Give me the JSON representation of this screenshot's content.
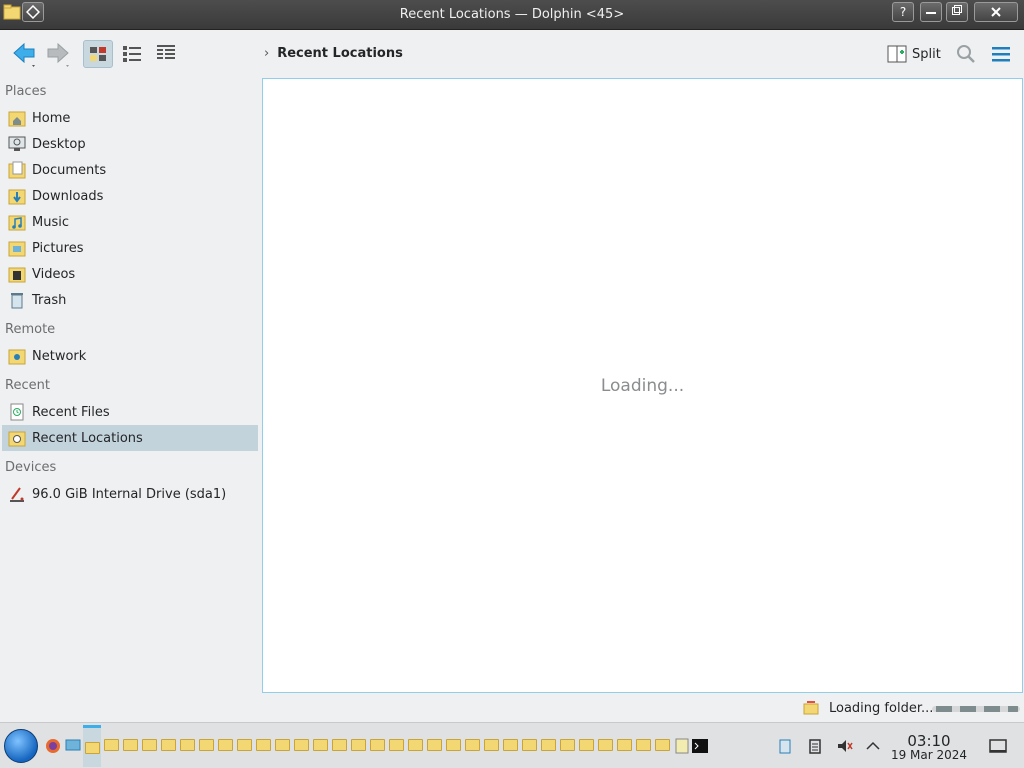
{
  "window": {
    "title": "Recent Locations — Dolphin <45>",
    "help_label": "?"
  },
  "toolbar": {
    "breadcrumb": "Recent Locations",
    "split_label": "Split"
  },
  "sidebar": {
    "sections": [
      {
        "title": "Places",
        "items": [
          {
            "label": "Home",
            "icon": "home-folder-icon"
          },
          {
            "label": "Desktop",
            "icon": "desktop-icon"
          },
          {
            "label": "Documents",
            "icon": "documents-folder-icon"
          },
          {
            "label": "Downloads",
            "icon": "downloads-folder-icon"
          },
          {
            "label": "Music",
            "icon": "music-folder-icon"
          },
          {
            "label": "Pictures",
            "icon": "pictures-folder-icon"
          },
          {
            "label": "Videos",
            "icon": "videos-folder-icon"
          },
          {
            "label": "Trash",
            "icon": "trash-icon"
          }
        ]
      },
      {
        "title": "Remote",
        "items": [
          {
            "label": "Network",
            "icon": "network-folder-icon"
          }
        ]
      },
      {
        "title": "Recent",
        "items": [
          {
            "label": "Recent Files",
            "icon": "recent-files-icon"
          },
          {
            "label": "Recent Locations",
            "icon": "recent-locations-icon",
            "selected": true
          }
        ]
      },
      {
        "title": "Devices",
        "items": [
          {
            "label": "96.0 GiB Internal Drive (sda1)",
            "icon": "drive-icon"
          }
        ]
      }
    ]
  },
  "content": {
    "placeholder": "Loading..."
  },
  "statusbar": {
    "text": "Loading folder..."
  },
  "taskbar": {
    "time": "03:10",
    "date": "19 Mar 2024"
  },
  "colors": {
    "accent": "#3daee9",
    "selection": "#c3d3dc",
    "folder": "#f3d772"
  }
}
